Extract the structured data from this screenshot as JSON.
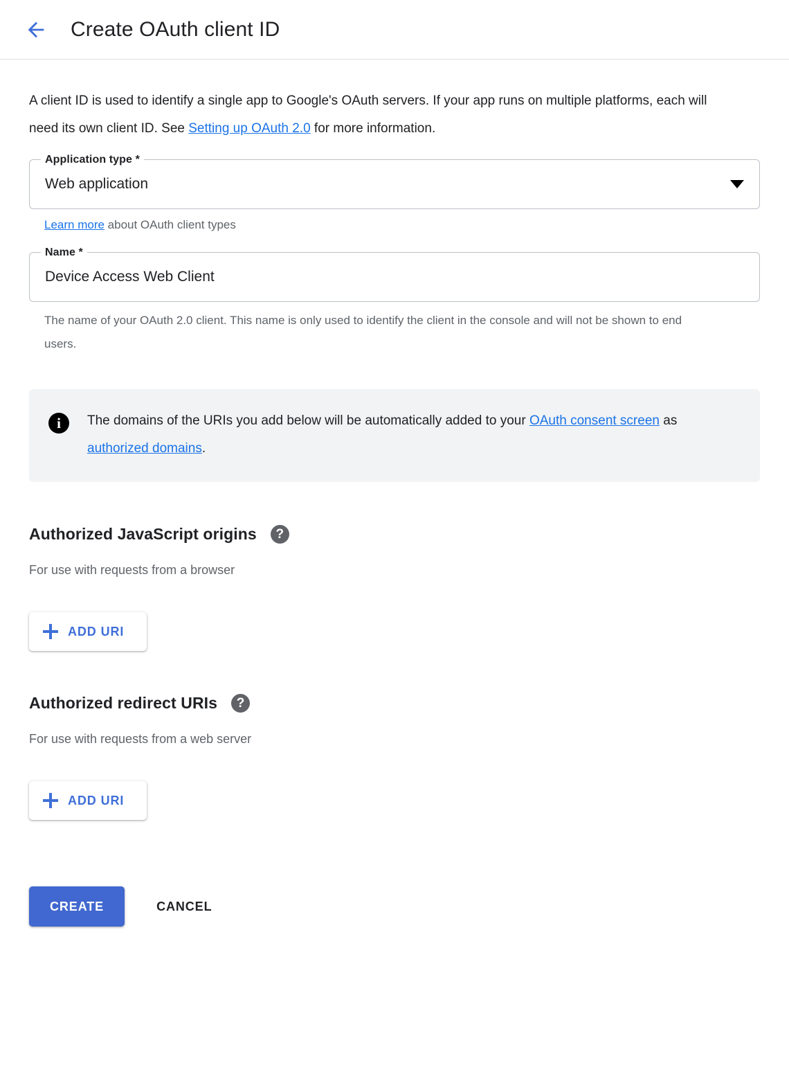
{
  "header": {
    "back_icon": "arrow-left-icon",
    "title": "Create OAuth client ID"
  },
  "intro": {
    "part1": "A client ID is used to identify a single app to Google's OAuth servers. If your app runs on multiple platforms, each will need its own client ID. See ",
    "link": "Setting up OAuth 2.0",
    "part2": " for more information."
  },
  "application_type": {
    "label": "Application type *",
    "value": "Web application",
    "options": [
      "Web application"
    ],
    "arrow_icon": "chevron-down-icon",
    "helper_link": "Learn more",
    "helper_rest": " about OAuth client types"
  },
  "name_field": {
    "label": "Name *",
    "value": "Device Access Web Client",
    "placeholder": "",
    "helper": "The name of your OAuth 2.0 client. This name is only used to identify the client in the console and will not be shown to end users."
  },
  "info_banner": {
    "icon": "info-icon",
    "part1": "The domains of the URIs you add below will be automatically added to your ",
    "link1": "OAuth consent screen",
    "part2": " as ",
    "link2": "authorized domains",
    "part3": "."
  },
  "javascript_origins": {
    "title": "Authorized JavaScript origins",
    "help_icon": "help-icon",
    "subtitle": "For use with requests from a browser",
    "add_button": "ADD URI",
    "add_icon": "plus-icon"
  },
  "redirect_uris": {
    "title": "Authorized redirect URIs",
    "help_icon": "help-icon",
    "subtitle": "For use with requests from a web server",
    "add_button": "ADD URI",
    "add_icon": "plus-icon"
  },
  "actions": {
    "create": "CREATE",
    "cancel": "CANCEL"
  },
  "colors": {
    "link": "#1a73e8",
    "primary_button": "#4168d0",
    "accent": "#3f6fd8",
    "banner_bg": "#f1f3f4",
    "muted_text": "#5f6368"
  }
}
